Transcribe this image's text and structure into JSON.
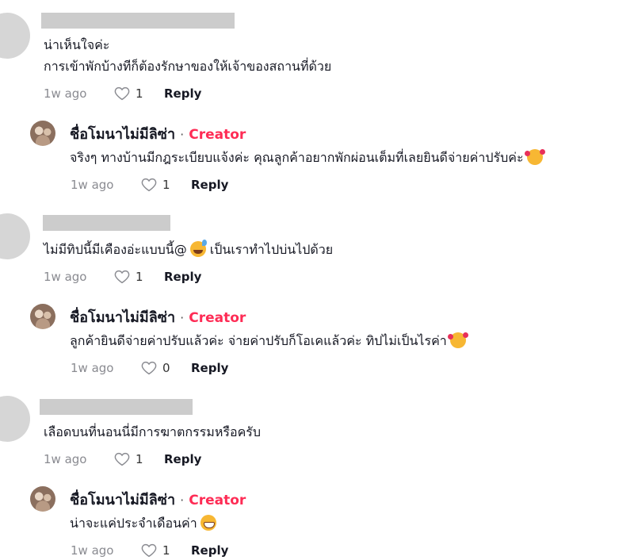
{
  "comments": [
    {
      "lines": [
        "น่าเห็นใจค่ะ",
        "การเข้าพักบ้างทีก็ต้องรักษาของให้เจ้าของสถานที่ด้วย"
      ],
      "time": "1w ago",
      "likes": "1",
      "reply_label": "Reply",
      "reply": {
        "author": "ชื่อโมนาไม่มีลิซ่า",
        "separator": "·",
        "badge": "Creator",
        "text": "จริงๆ ทางบ้านมีกฎระเบียบแจ้งค่ะ คุณลูกค้าอยากพักผ่อนเต็มที่เลยยินดีจ่ายค่าปรับค่ะ",
        "emoji": "smiling-face-with-hearts",
        "time": "1w ago",
        "likes": "1",
        "reply_label": "Reply"
      }
    },
    {
      "text_before": "ไม่มีทิปนี้มีเคืองอ่ะแบบนี้@",
      "emoji": "grinning-face-with-sweat",
      "text_after": " เป็นเราทำไปบ่นไปด้วย",
      "time": "1w ago",
      "likes": "1",
      "reply_label": "Reply",
      "reply": {
        "author": "ชื่อโมนาไม่มีลิซ่า",
        "separator": "·",
        "badge": "Creator",
        "text": "ลูกค้ายินดีจ่ายค่าปรับแล้วค่ะ จ่ายค่าปรับก็โอเคแล้วค่ะ ทิปไม่เป็นไรค่า",
        "emoji": "smiling-face-with-hearts",
        "time": "1w ago",
        "likes": "0",
        "reply_label": "Reply"
      }
    },
    {
      "text": "เลือดบนที่นอนนี่มีการฆาตกรรมหรือครับ",
      "time": "1w ago",
      "likes": "1",
      "reply_label": "Reply",
      "reply": {
        "author": "ชื่อโมนาไม่มีลิซ่า",
        "separator": "·",
        "badge": "Creator",
        "text": "น่าจะแค่ประจำเดือนค่า",
        "emoji": "beaming-face",
        "time": "1w ago",
        "likes": "1",
        "reply_label": "Reply"
      }
    }
  ],
  "icons": {
    "like": "heart-outline-icon"
  },
  "colors": {
    "creator": "#fe2c55",
    "meta": "#8a8b91",
    "text": "#161823"
  }
}
